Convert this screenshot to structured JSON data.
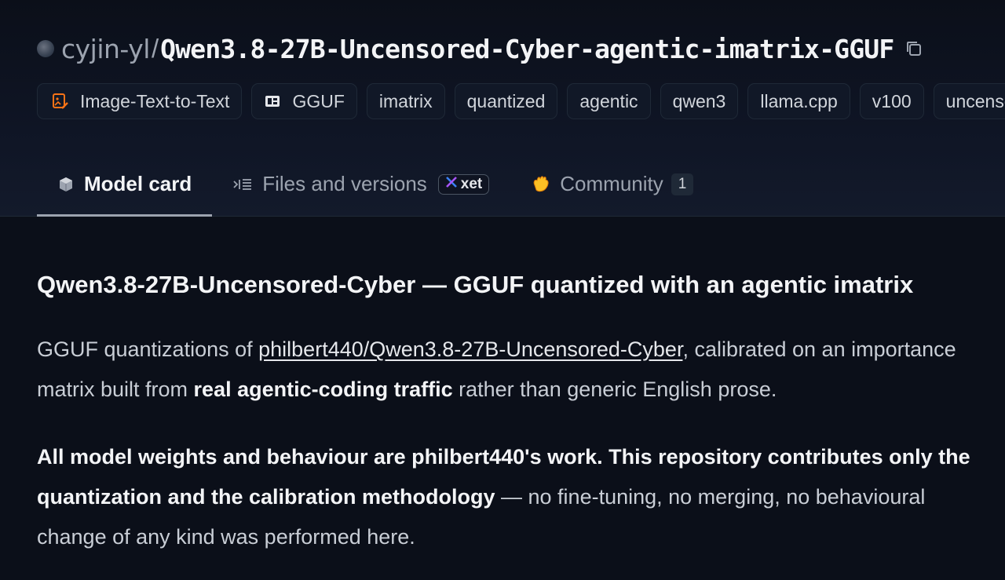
{
  "repo": {
    "owner": "cyjin-yl",
    "separator": "/",
    "name": "Qwen3.8-27B-Uncensored-Cyber-agentic-imatrix-GGUF"
  },
  "tags": [
    {
      "label": "Image-Text-to-Text",
      "icon": "image-text-icon",
      "color": "#f97316"
    },
    {
      "label": "GGUF",
      "icon": "gguf-icon"
    },
    {
      "label": "imatrix"
    },
    {
      "label": "quantized"
    },
    {
      "label": "agentic"
    },
    {
      "label": "qwen3"
    },
    {
      "label": "llama.cpp"
    },
    {
      "label": "v100"
    },
    {
      "label": "uncenso"
    }
  ],
  "tabs": {
    "model_card": "Model card",
    "files": "Files and versions",
    "xet_badge": "xet",
    "community": "Community",
    "community_count": "1"
  },
  "content": {
    "heading": "Qwen3.8-27B-Uncensored-Cyber — GGUF quantized with an agentic imatrix",
    "p1_prefix": "GGUF quantizations of ",
    "p1_link": "philbert440/Qwen3.8-27B-Uncensored-Cyber",
    "p1_mid": ", calibrated on an importance matrix built from ",
    "p1_bold": "real agentic-coding traffic",
    "p1_suffix": " rather than generic English prose.",
    "p2_bold": "All model weights and behaviour are philbert440's work. This repository contributes only the quantization and the calibration methodology",
    "p2_suffix": " — no fine-tuning, no merging, no behavioural change of any kind was performed here."
  },
  "colors": {
    "background": "#0b0f19",
    "accent_orange": "#f97316",
    "xet_blue": "#3b82f6"
  }
}
